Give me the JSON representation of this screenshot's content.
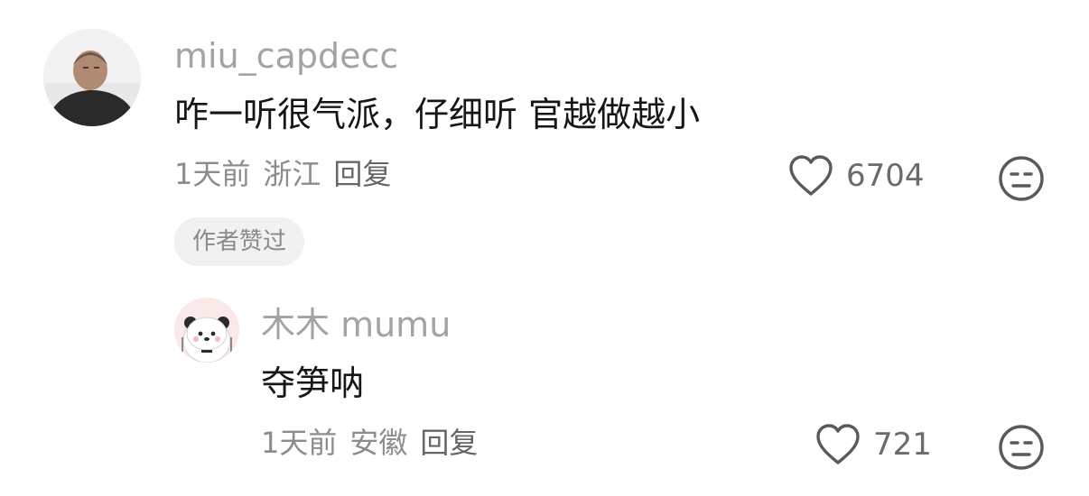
{
  "comment": {
    "username": "miu_capdecc",
    "text": "咋一听很气派，仔细听 官越做越小",
    "time": "1天前",
    "location": "浙江",
    "reply_label": "回复",
    "like_count": "6704",
    "badge": "作者赞过"
  },
  "reply": {
    "username": "木木 mumu",
    "text": "夺笋呐",
    "time": "1天前",
    "location": "安徽",
    "reply_label": "回复",
    "like_count": "721"
  },
  "icons": {
    "like": "heart-outline-icon",
    "dislike": "unamused-face-icon"
  }
}
